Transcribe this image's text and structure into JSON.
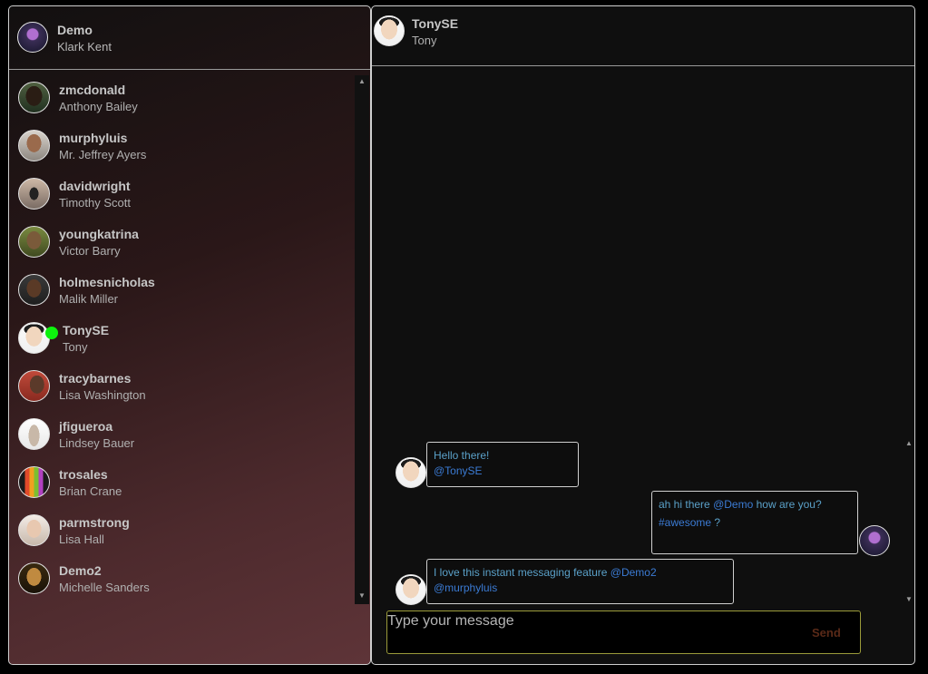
{
  "current_user": {
    "username": "Demo",
    "name": "Klark Kent",
    "avatar_icon": "user-avatar-icon"
  },
  "contacts": [
    {
      "username": "zmcdonald",
      "name": "Anthony Bailey",
      "online": false
    },
    {
      "username": "murphyluis",
      "name": "Mr. Jeffrey Ayers",
      "online": false
    },
    {
      "username": "davidwright",
      "name": "Timothy Scott",
      "online": false
    },
    {
      "username": "youngkatrina",
      "name": "Victor Barry",
      "online": false
    },
    {
      "username": "holmesnicholas",
      "name": "Malik Miller",
      "online": false
    },
    {
      "username": "TonySE",
      "name": "Tony",
      "online": true
    },
    {
      "username": "tracybarnes",
      "name": "Lisa Washington",
      "online": false
    },
    {
      "username": "jfigueroa",
      "name": "Lindsey Bauer",
      "online": false
    },
    {
      "username": "trosales",
      "name": "Brian Crane",
      "online": false
    },
    {
      "username": "parmstrong",
      "name": "Lisa Hall",
      "online": false
    },
    {
      "username": "Demo2",
      "name": "Michelle Sanders",
      "online": false
    }
  ],
  "chat": {
    "username": "TonySE",
    "name": "Tony",
    "messages": [
      {
        "from": "TonySE",
        "parts": {
          "text": "Hello there!",
          "mention": "@TonySE"
        }
      },
      {
        "from": "Demo",
        "parts": {
          "text1": "ah hi there",
          "mention": "@Demo",
          "text2": "how are you?",
          "tag": "#awesome",
          "text3": "?"
        }
      },
      {
        "from": "TonySE",
        "parts": {
          "text": "I love this instant messaging feature",
          "mention1": "@Demo2",
          "mention2": "@murphyluis"
        }
      }
    ]
  },
  "composer": {
    "placeholder": "Type your message",
    "send_label": "Send"
  },
  "scroll": {
    "up": "▲",
    "down": "▼"
  },
  "colors": {
    "online": "#0df20d",
    "mention": "#3b7bd4",
    "message_text": "#5aa0c8",
    "input_border": "#9b9b3a",
    "send": "#5a2a18"
  }
}
